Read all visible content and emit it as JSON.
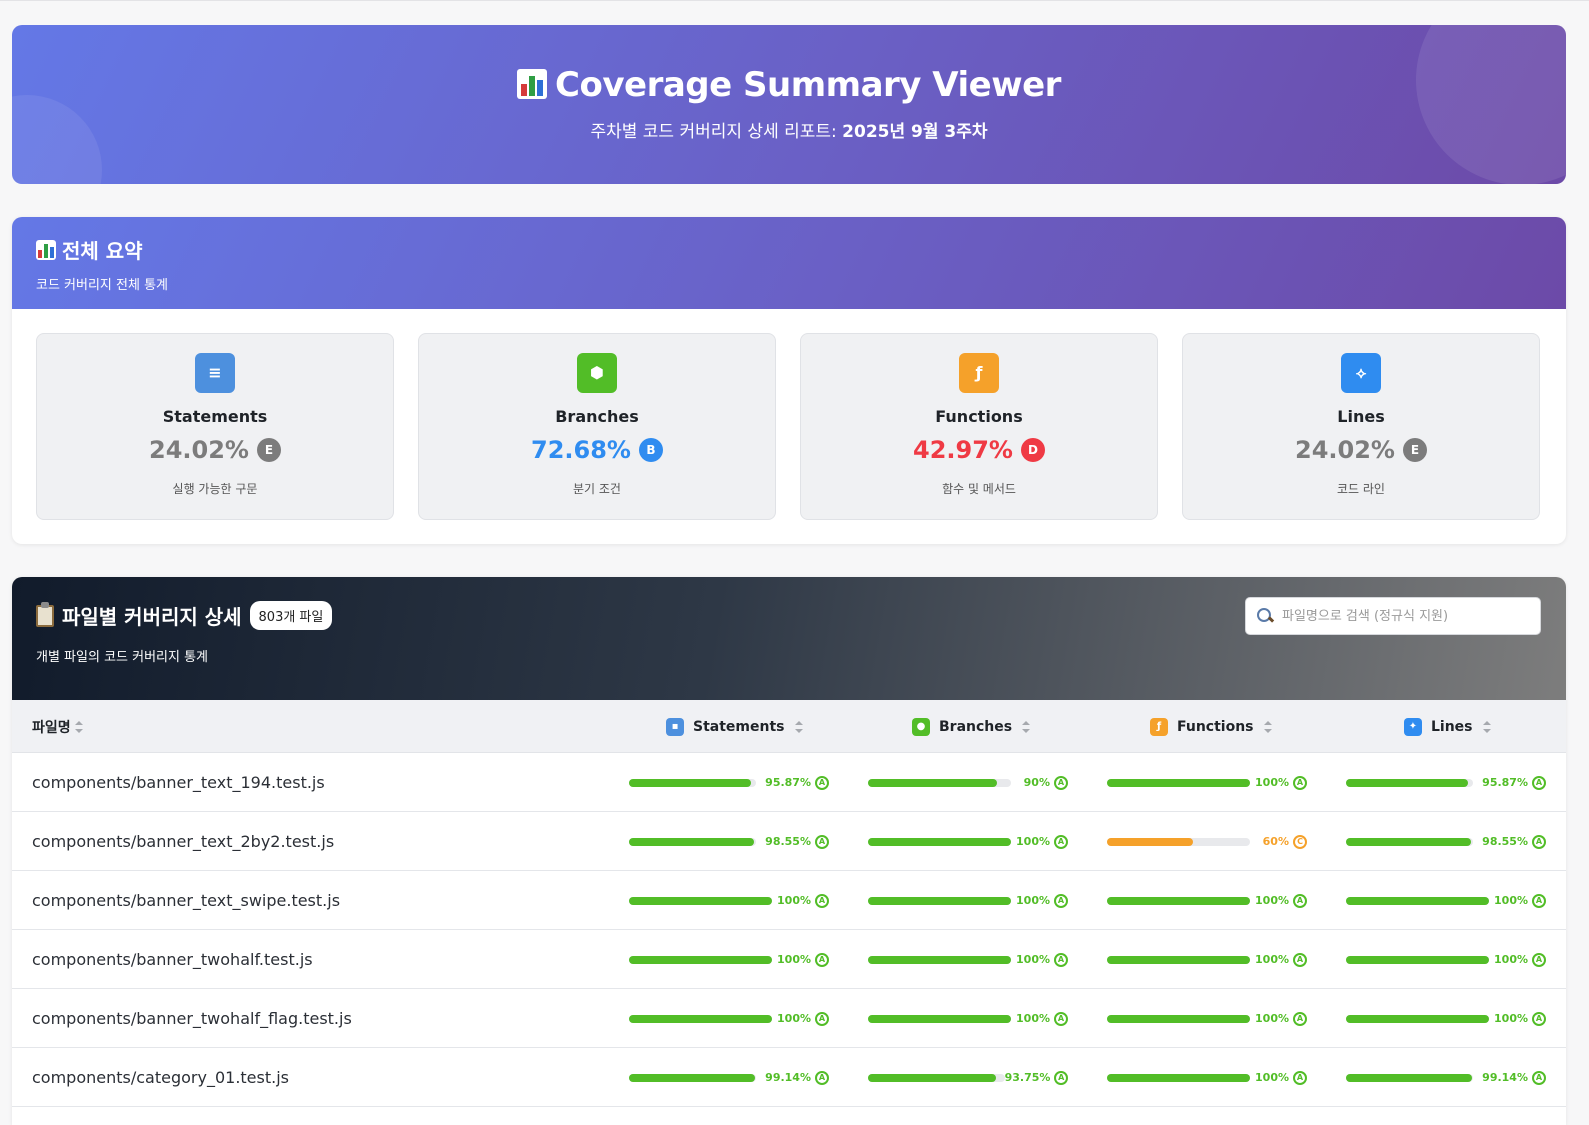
{
  "colors": {
    "grade_A": "#52bd27",
    "grade_B": "#2f8cf0",
    "grade_C": "#f5a12a",
    "grade_D": "#ef3a44",
    "grade_E": "#7c7c7c",
    "statements": "#4d90de",
    "branches": "#52bd27",
    "functions": "#f5a12a",
    "lines": "#2f8cf0"
  },
  "hero": {
    "title": "Coverage Summary Viewer",
    "subtitle_prefix": "주차별 코드 커버리지 상세 리포트: ",
    "subtitle_week": "2025년 9월 3주차",
    "icon": "bar-chart-icon"
  },
  "summary": {
    "title": "전체 요약",
    "subtitle": "코드 커버리지 전체 통계",
    "metrics": [
      {
        "name": "Statements",
        "value": "24.02%",
        "grade": "E",
        "desc": "실행 가능한 구문",
        "icon": "≡",
        "icon_name": "statements-icon"
      },
      {
        "name": "Branches",
        "value": "72.68%",
        "grade": "B",
        "desc": "분기 조건",
        "icon": "⬢",
        "icon_name": "branches-icon"
      },
      {
        "name": "Functions",
        "value": "42.97%",
        "grade": "D",
        "desc": "함수 및 메서드",
        "icon": "ƒ",
        "icon_name": "functions-icon"
      },
      {
        "name": "Lines",
        "value": "24.02%",
        "grade": "E",
        "desc": "코드 라인",
        "icon": "⟡",
        "icon_name": "lines-icon"
      }
    ]
  },
  "files": {
    "title": "파일별 커버리지 상세",
    "count": "803개 파일",
    "subtitle": "개별 파일의 코드 커버리지 통계",
    "search_placeholder": "파일명으로 검색 (정규식 지원)",
    "columns": {
      "file": "파일명",
      "statements": "Statements",
      "branches": "Branches",
      "functions": "Functions",
      "lines": "Lines"
    },
    "rows": [
      {
        "file": "components/banner_text_194.test.js",
        "statements": {
          "pct": "95.87%",
          "ratio": 0.9587,
          "grade": "A"
        },
        "branches": {
          "pct": "90%",
          "ratio": 0.9,
          "grade": "A"
        },
        "functions": {
          "pct": "100%",
          "ratio": 1.0,
          "grade": "A"
        },
        "lines": {
          "pct": "95.87%",
          "ratio": 0.9587,
          "grade": "A"
        }
      },
      {
        "file": "components/banner_text_2by2.test.js",
        "statements": {
          "pct": "98.55%",
          "ratio": 0.9855,
          "grade": "A"
        },
        "branches": {
          "pct": "100%",
          "ratio": 1.0,
          "grade": "A"
        },
        "functions": {
          "pct": "60%",
          "ratio": 0.6,
          "grade": "C"
        },
        "lines": {
          "pct": "98.55%",
          "ratio": 0.9855,
          "grade": "A"
        }
      },
      {
        "file": "components/banner_text_swipe.test.js",
        "statements": {
          "pct": "100%",
          "ratio": 1.0,
          "grade": "A"
        },
        "branches": {
          "pct": "100%",
          "ratio": 1.0,
          "grade": "A"
        },
        "functions": {
          "pct": "100%",
          "ratio": 1.0,
          "grade": "A"
        },
        "lines": {
          "pct": "100%",
          "ratio": 1.0,
          "grade": "A"
        }
      },
      {
        "file": "components/banner_twohalf.test.js",
        "statements": {
          "pct": "100%",
          "ratio": 1.0,
          "grade": "A"
        },
        "branches": {
          "pct": "100%",
          "ratio": 1.0,
          "grade": "A"
        },
        "functions": {
          "pct": "100%",
          "ratio": 1.0,
          "grade": "A"
        },
        "lines": {
          "pct": "100%",
          "ratio": 1.0,
          "grade": "A"
        }
      },
      {
        "file": "components/banner_twohalf_flag.test.js",
        "statements": {
          "pct": "100%",
          "ratio": 1.0,
          "grade": "A"
        },
        "branches": {
          "pct": "100%",
          "ratio": 1.0,
          "grade": "A"
        },
        "functions": {
          "pct": "100%",
          "ratio": 1.0,
          "grade": "A"
        },
        "lines": {
          "pct": "100%",
          "ratio": 1.0,
          "grade": "A"
        }
      },
      {
        "file": "components/category_01.test.js",
        "statements": {
          "pct": "99.14%",
          "ratio": 0.9914,
          "grade": "A"
        },
        "branches": {
          "pct": "93.75%",
          "ratio": 0.9375,
          "grade": "A"
        },
        "functions": {
          "pct": "100%",
          "ratio": 1.0,
          "grade": "A"
        },
        "lines": {
          "pct": "99.14%",
          "ratio": 0.9914,
          "grade": "A"
        }
      }
    ]
  }
}
